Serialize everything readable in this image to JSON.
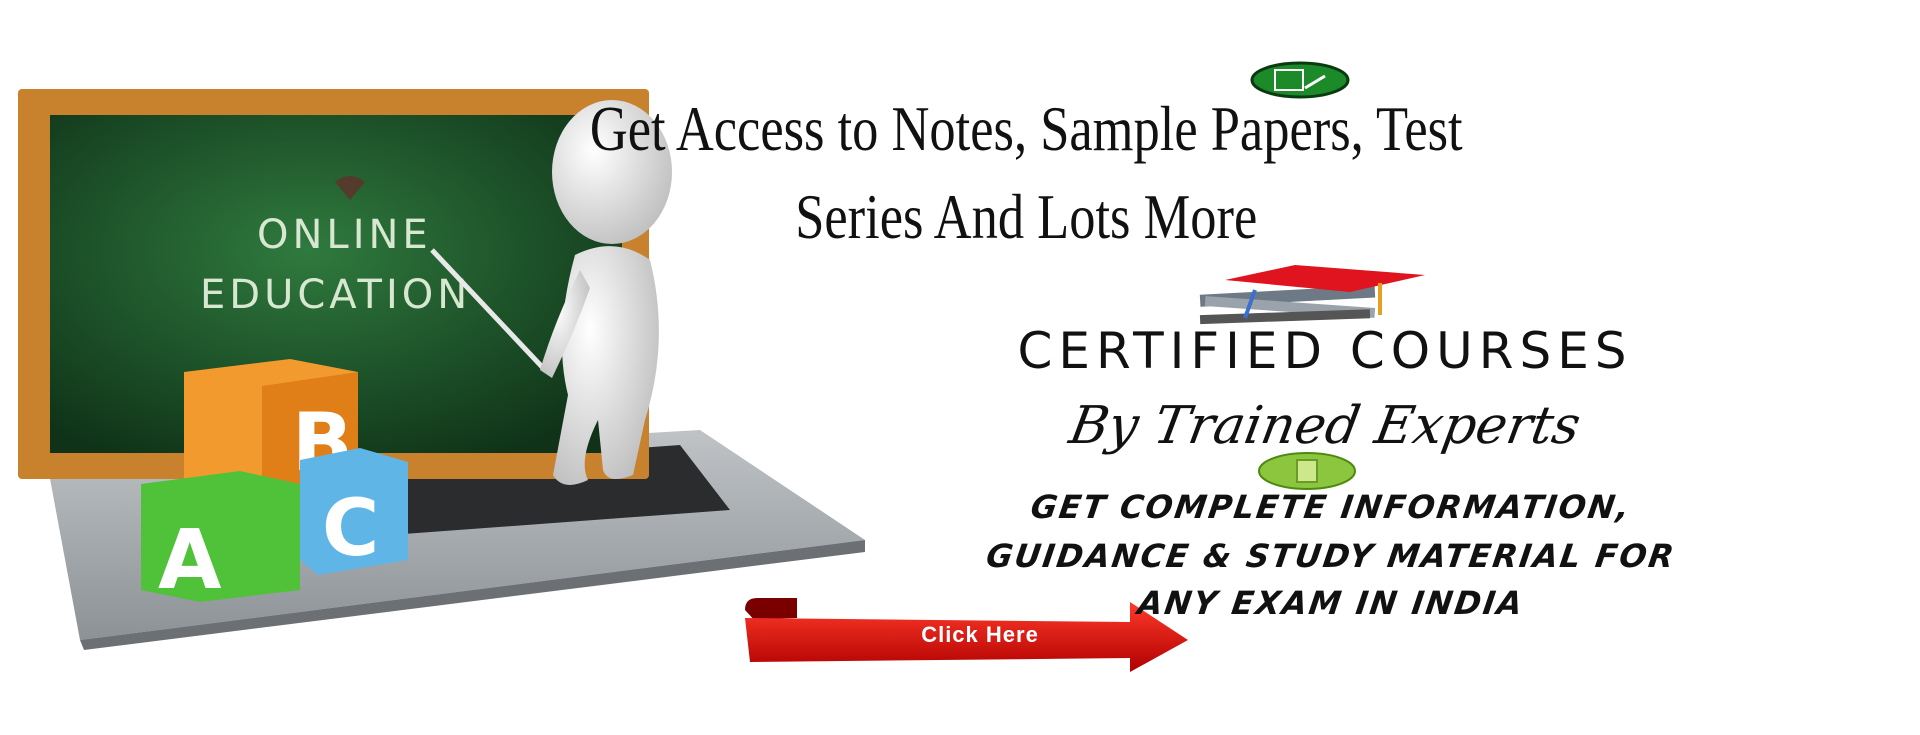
{
  "illustration": {
    "board_line1": "ONLINE",
    "board_line2": "EDUCATION",
    "block_b": "B",
    "block_a": "A",
    "block_c": "C"
  },
  "headline": {
    "line1": "Get Access to Notes, Sample Papers, Test",
    "line2": "Series And Lots More"
  },
  "certified": "CERTIFIED COURSES",
  "tagline": "By Trained Experts",
  "info": {
    "line1": "GET COMPLETE INFORMATION,",
    "line2": "GUIDANCE & STUDY MATERIAL FOR",
    "line3": "ANY EXAM IN INDIA"
  },
  "cta": {
    "label": "Click Here"
  },
  "colors": {
    "board": "#1f5a2c",
    "frame": "#c8822e",
    "cta": "#e01010",
    "icon_green": "#1d8a2a",
    "icon_lime": "#8cc63f"
  }
}
